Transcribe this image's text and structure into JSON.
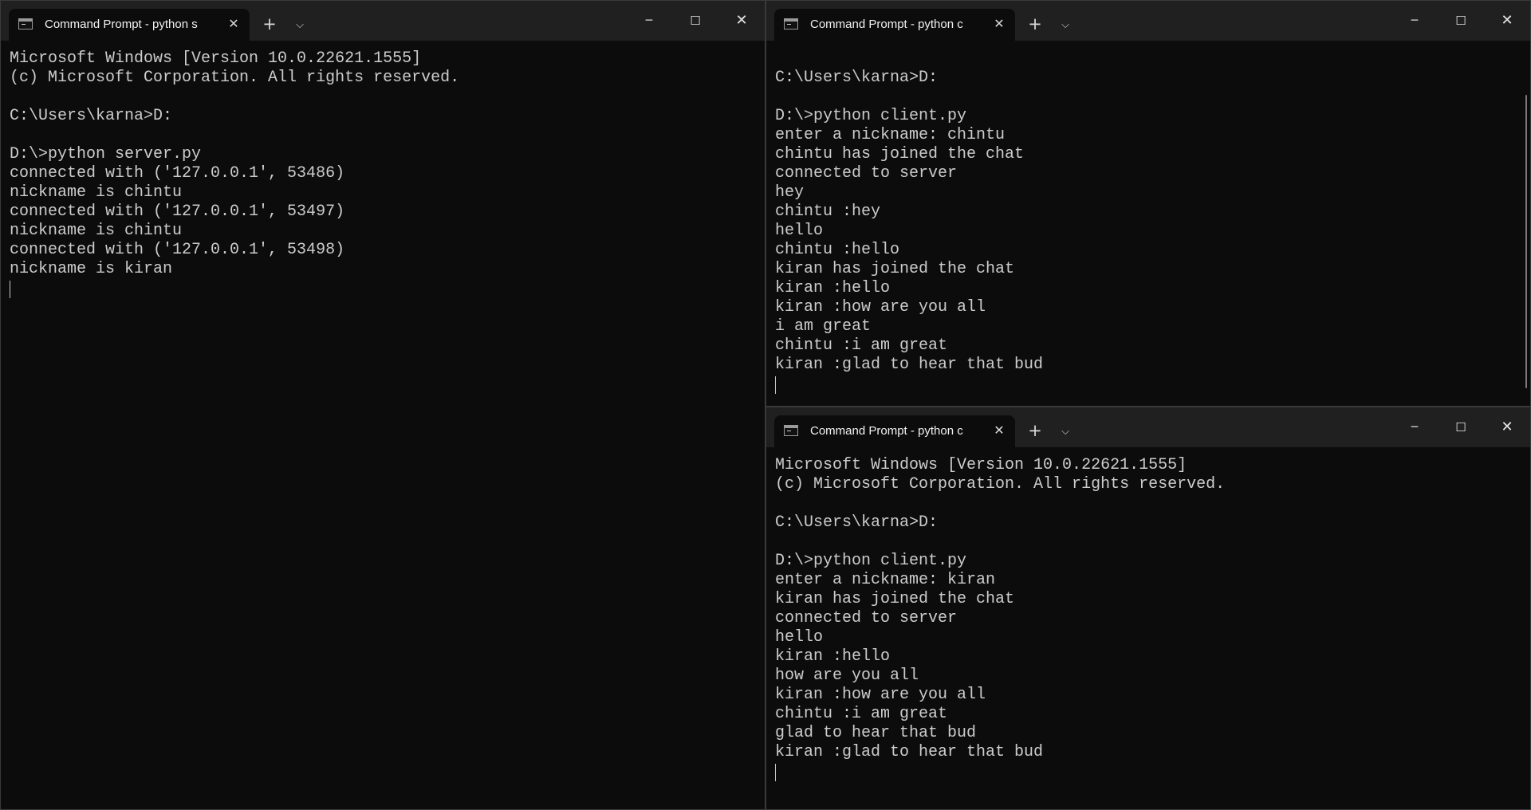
{
  "windows": [
    {
      "tab_title": "Command Prompt - python s",
      "lines": [
        "Microsoft Windows [Version 10.0.22621.1555]",
        "(c) Microsoft Corporation. All rights reserved.",
        "",
        "C:\\Users\\karna>D:",
        "",
        "D:\\>python server.py",
        "connected with ('127.0.0.1', 53486)",
        "nickname is chintu",
        "connected with ('127.0.0.1', 53497)",
        "nickname is chintu",
        "connected with ('127.0.0.1', 53498)",
        "nickname is kiran"
      ]
    },
    {
      "tab_title": "Command Prompt - python c",
      "lines": [
        "",
        "C:\\Users\\karna>D:",
        "",
        "D:\\>python client.py",
        "enter a nickname: chintu",
        "chintu has joined the chat",
        "connected to server",
        "hey",
        "chintu :hey",
        "hello",
        "chintu :hello",
        "kiran has joined the chat",
        "kiran :hello",
        "kiran :how are you all",
        "i am great",
        "chintu :i am great",
        "kiran :glad to hear that bud"
      ]
    },
    {
      "tab_title": "Command Prompt - python c",
      "lines": [
        "Microsoft Windows [Version 10.0.22621.1555]",
        "(c) Microsoft Corporation. All rights reserved.",
        "",
        "C:\\Users\\karna>D:",
        "",
        "D:\\>python client.py",
        "enter a nickname: kiran",
        "kiran has joined the chat",
        "connected to server",
        "hello",
        "kiran :hello",
        "how are you all",
        "kiran :how are you all",
        "chintu :i am great",
        "glad to hear that bud",
        "kiran :glad to hear that bud"
      ]
    }
  ],
  "controls": {
    "tab_close": "✕",
    "new_tab": "+",
    "dropdown": "⌵",
    "minimize": "─",
    "maximize": "☐",
    "close": "✕"
  },
  "icons": {
    "tab": "cmd-icon",
    "tab_close": "close-icon",
    "new_tab": "plus-icon",
    "dropdown": "chevron-down-icon",
    "minimize": "minimize-icon",
    "maximize": "maximize-icon",
    "close": "close-icon"
  },
  "colors": {
    "console_background": "#0c0c0c",
    "titlebar_background": "#202020",
    "console_text": "#cccccc",
    "tab_text": "#f2f2f2"
  }
}
